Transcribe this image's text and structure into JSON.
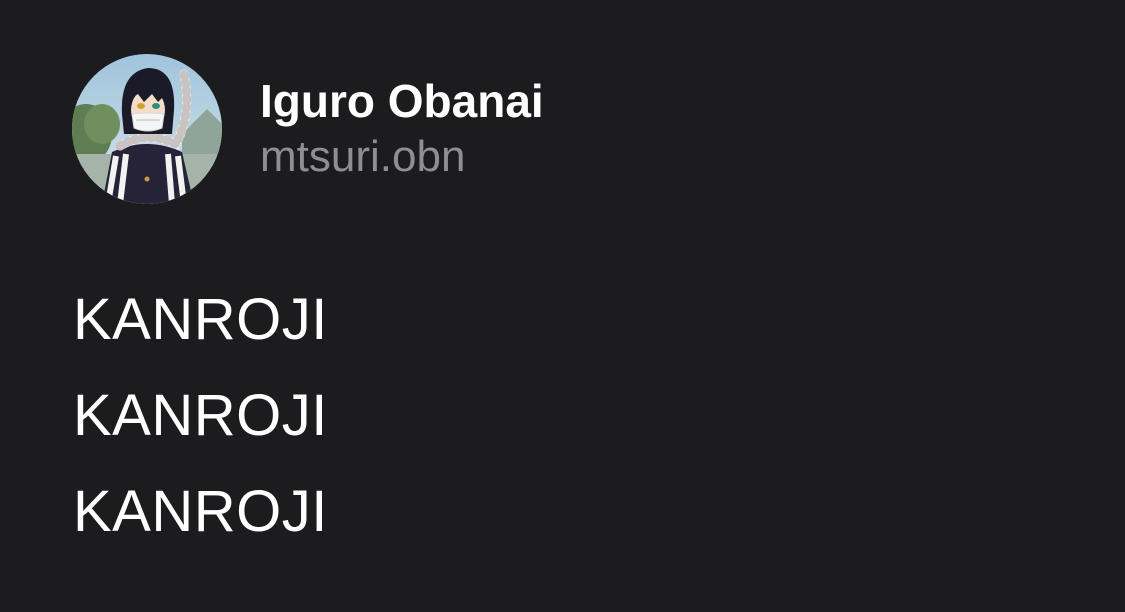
{
  "author": {
    "display_name": "Iguro Obanai",
    "handle": "mtsuri.obn"
  },
  "post": {
    "lines": [
      "KANROJI",
      "KANROJI",
      "KANROJI"
    ]
  },
  "colors": {
    "background": "#1c1c1e",
    "primary_text": "#ffffff",
    "secondary_text": "#8e8e93"
  }
}
